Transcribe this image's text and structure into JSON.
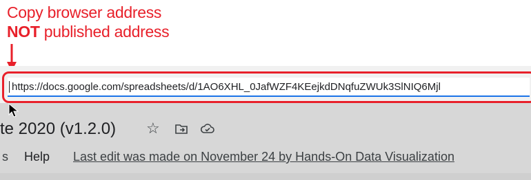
{
  "annotation": {
    "line1": "Copy browser address",
    "line2_bold": "NOT",
    "line2_rest": " published address",
    "accent_color": "#e8202a"
  },
  "browser": {
    "url": "https://docs.google.com/spreadsheets/d/1AO6XHL_0JafWZF4KEejkdDNqfuZWUk3SlNIQ6Mjl"
  },
  "sheet": {
    "title": "te 2020 (v1.2.0)",
    "icons": [
      "star-icon",
      "move-to-folder-icon",
      "cloud-status-icon"
    ],
    "menu": {
      "partial_item": "s",
      "help": "Help",
      "last_edit": "Last edit was made on November 24 by Hands-On Data Visualization"
    }
  }
}
